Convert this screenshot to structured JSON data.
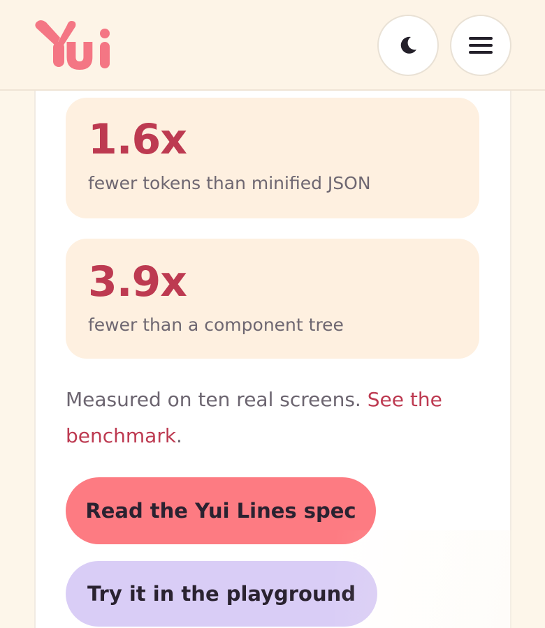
{
  "header": {
    "logo_text": "Yui",
    "brand_color": "#f47684",
    "theme_toggle_icon": "moon-icon",
    "menu_icon": "hamburger-menu-icon"
  },
  "stats": [
    {
      "value": "1.6x",
      "label": "fewer tokens than minified JSON"
    },
    {
      "value": "3.9x",
      "label": "fewer than a component tree"
    }
  ],
  "note": {
    "text": "Measured on ten real screens. ",
    "link_label": "See the benchmark",
    "after_link": "."
  },
  "actions": {
    "primary_label": "Read the Yui Lines spec",
    "secondary_label": "Try it in the playground"
  },
  "colors": {
    "accent": "#bd3a51",
    "primary_button": "#fd7b82",
    "secondary_button": "#d9cdf6",
    "stat_card_bg": "#fef0e0"
  }
}
